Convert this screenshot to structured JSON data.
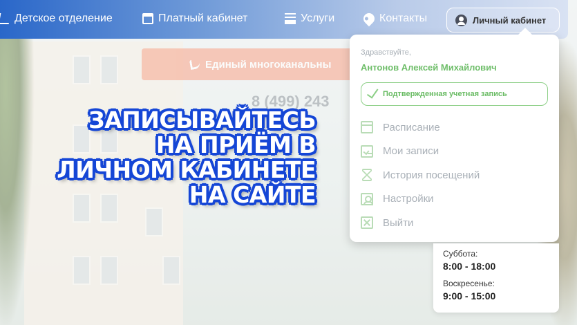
{
  "nav": {
    "items": [
      {
        "label": "Детское отделение",
        "icon": "stethoscope-icon"
      },
      {
        "label": "Платный кабинет",
        "icon": "card-icon"
      },
      {
        "label": "Услуги",
        "icon": "list-icon"
      },
      {
        "label": "Контакты",
        "icon": "location-pin-icon"
      }
    ],
    "cabinet_label": "Личный кабинет"
  },
  "background_page": {
    "phone_banner": "Единый многоканальны",
    "phone_number": "8 (499) 243"
  },
  "headline": {
    "lines": [
      "Записывайтесь",
      "на приём в",
      "личном кабинете",
      "на сайте"
    ]
  },
  "dropdown": {
    "greeting": "Здравствуйте,",
    "user_name": "Антонов Алексей Михайлович",
    "verified_label": "Подтвержденная учетная запись",
    "menu": [
      {
        "label": "Расписание",
        "icon": "calendar-icon"
      },
      {
        "label": "Мои записи",
        "icon": "notes-icon"
      },
      {
        "label": "История посещений",
        "icon": "hourglass-icon"
      },
      {
        "label": "Настройки",
        "icon": "settings-user-icon"
      },
      {
        "label": "Выйти",
        "icon": "exit-icon"
      }
    ]
  },
  "schedule": [
    {
      "day": "Суббота:",
      "time": "8:00 - 18:00"
    },
    {
      "day": "Воскресенье:",
      "time": "9:00 - 15:00"
    }
  ],
  "colors": {
    "nav_blue": "#2a67c9",
    "headline_stroke": "#1546d6",
    "accent_green": "#6fbe6a"
  }
}
